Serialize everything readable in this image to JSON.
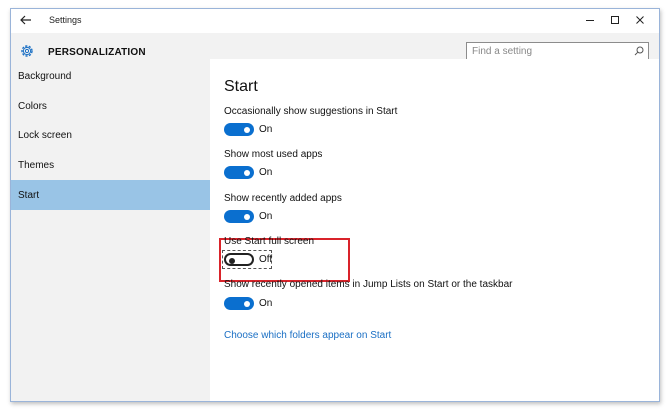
{
  "window": {
    "title": "Settings"
  },
  "header": {
    "section": "PERSONALIZATION",
    "search_placeholder": "Find a setting"
  },
  "sidebar": {
    "items": [
      {
        "label": "Background"
      },
      {
        "label": "Colors"
      },
      {
        "label": "Lock screen"
      },
      {
        "label": "Themes"
      },
      {
        "label": "Start",
        "selected": true
      }
    ]
  },
  "content": {
    "title": "Start",
    "settings": [
      {
        "label": "Occasionally show suggestions in Start",
        "state": "On"
      },
      {
        "label": "Show most used apps",
        "state": "On"
      },
      {
        "label": "Show recently added apps",
        "state": "On"
      },
      {
        "label": "Use Start full screen",
        "state": "Off"
      },
      {
        "label": "Show recently opened items in Jump Lists on Start or the taskbar",
        "state": "On"
      }
    ],
    "link": "Choose which folders appear on Start"
  },
  "colors": {
    "accent": "#0a6fcf",
    "selected_nav": "#99c4e6",
    "highlight": "#d9232a",
    "link": "#1a6fc4"
  },
  "icons": [
    "back-arrow-icon",
    "minimize-icon",
    "maximize-icon",
    "close-icon",
    "gear-icon",
    "search-icon"
  ]
}
